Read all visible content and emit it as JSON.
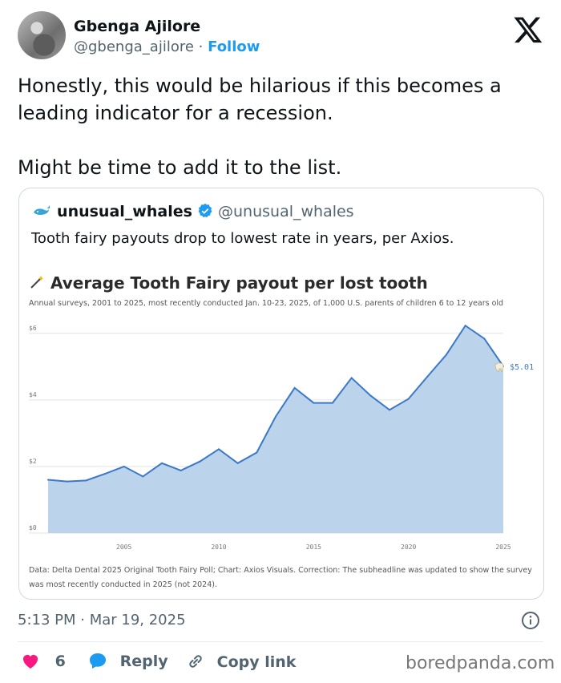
{
  "author": {
    "name": "Gbenga Ajilore",
    "handle": "@gbenga_ajilore",
    "separator": "·",
    "follow_label": "Follow"
  },
  "tweet": {
    "text": "Honestly, this would be hilarious if this becomes a\nleading indicator for a recession.\n\nMight be time to add it to the list.",
    "timestamp": "5:13 PM · Mar 19, 2025"
  },
  "quote": {
    "name": "unusual_whales",
    "handle": "@unusual_whales",
    "text": "Tooth fairy payouts drop to lowest rate in years, per Axios."
  },
  "chart_data": {
    "type": "area",
    "title": "Average Tooth Fairy payout per lost tooth",
    "subtitle": "Annual surveys, 2001 to 2025, most recently conducted Jan. 10-23, 2025, of 1,000 U.S. parents of children 6 to 12 years old",
    "footnote": "Data: Delta Dental 2025 Original Tooth Fairy Poll; Chart: Axios Visuals. Correction: The subheadline was updated to show the survey was most recently conducted in 2025 (not 2024).",
    "x": [
      2001,
      2002,
      2003,
      2004,
      2005,
      2006,
      2007,
      2008,
      2009,
      2010,
      2011,
      2012,
      2013,
      2014,
      2015,
      2016,
      2017,
      2018,
      2019,
      2020,
      2021,
      2022,
      2023,
      2024,
      2025
    ],
    "values": [
      1.6,
      1.55,
      1.58,
      1.78,
      2.0,
      1.7,
      2.1,
      1.88,
      2.15,
      2.52,
      2.1,
      2.42,
      3.5,
      4.36,
      3.91,
      3.91,
      4.66,
      4.13,
      3.7,
      4.03,
      4.7,
      5.36,
      6.23,
      5.84,
      5.01
    ],
    "x_ticks": [
      "2005",
      "2010",
      "2015",
      "2020",
      "2025"
    ],
    "y_ticks": [
      "$0",
      "$2",
      "$4",
      "$6"
    ],
    "ylim": [
      0,
      6.5
    ],
    "end_label": "$5.01",
    "colors": {
      "line": "#3a78c9",
      "fill": "#bcd3ec",
      "label": "#3a78c9"
    }
  },
  "actions": {
    "likes": "6",
    "reply_label": "Reply",
    "copy_label": "Copy link"
  },
  "watermark": "boredpanda.com"
}
